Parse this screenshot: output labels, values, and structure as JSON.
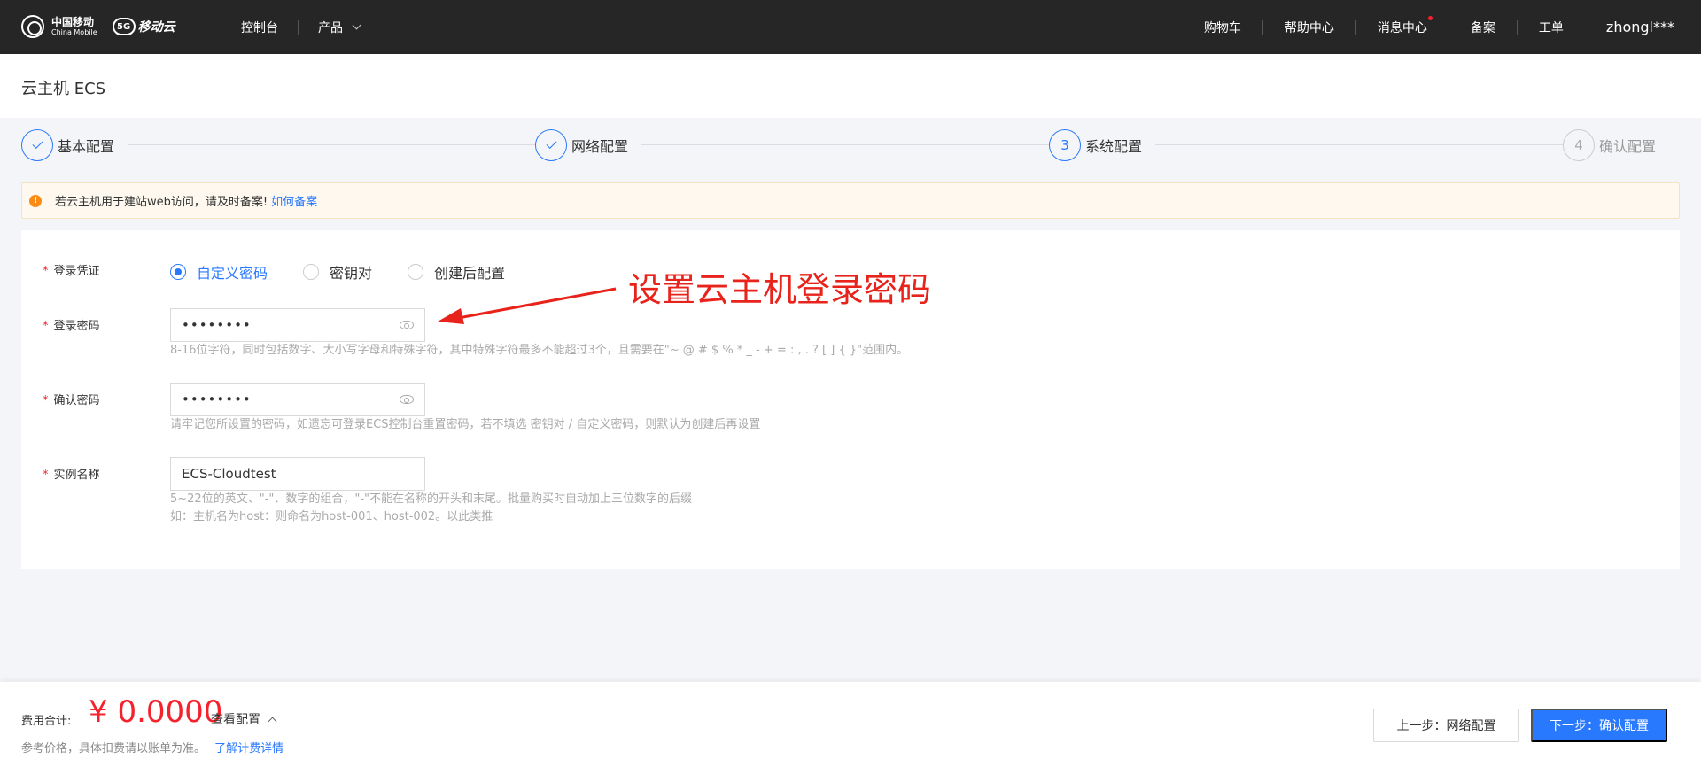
{
  "nav": {
    "logo_cn": "中国移动",
    "logo_en": "China Mobile",
    "logo_5g": "5G",
    "logo_brand": "移动云",
    "console": "控制台",
    "products": "产品",
    "cart": "购物车",
    "help": "帮助中心",
    "messages": "消息中心",
    "filing": "备案",
    "ticket": "工单",
    "user": "zhongl***"
  },
  "page_title": "云主机 ECS",
  "steps": [
    {
      "num": "1",
      "label": "基本配置",
      "state": "done"
    },
    {
      "num": "2",
      "label": "网络配置",
      "state": "done"
    },
    {
      "num": "3",
      "label": "系统配置",
      "state": "active"
    },
    {
      "num": "4",
      "label": "确认配置",
      "state": "inactive"
    }
  ],
  "alert": {
    "text": "若云主机用于建站web访问，请及时备案!",
    "link": "如何备案"
  },
  "form": {
    "credential": {
      "label": "登录凭证",
      "options": [
        "自定义密码",
        "密钥对",
        "创建后配置"
      ],
      "selected": "自定义密码"
    },
    "password": {
      "label": "登录密码",
      "value": "••••••••",
      "hint": "8-16位字符，同时包括数字、大小写字母和特殊字符，其中特殊字符最多不能超过3个，且需要在\"~ @ # $ % * _ - + = : , . ? [ ] { }\"范围内。"
    },
    "confirm": {
      "label": "确认密码",
      "value": "••••••••",
      "hint": "请牢记您所设置的密码，如遗忘可登录ECS控制台重置密码，若不填选 密钥对 / 自定义密码，则默认为创建后再设置"
    },
    "instance": {
      "label": "实例名称",
      "value": "ECS-Cloudtest",
      "hint1": "5~22位的英文、\"-\"、数字的组合，\"-\"不能在名称的开头和末尾。批量购买时自动加上三位数字的后缀",
      "hint2": "如：主机名为host：则命名为host-001、host-002。以此类推"
    }
  },
  "annotation": "设置云主机登录密码",
  "footer": {
    "fee_label": "费用合计:",
    "fee_value": "¥ 0.0000",
    "view_config": "查看配置",
    "ref_text": "参考价格，具体扣费请以账单为准。",
    "ref_link": "了解计费详情",
    "prev": "上一步：网络配置",
    "next": "下一步：确认配置"
  },
  "colors": {
    "accent": "#2979ff",
    "danger": "#f5222d",
    "annotation": "#e8231b",
    "nav_bg": "#262626"
  }
}
